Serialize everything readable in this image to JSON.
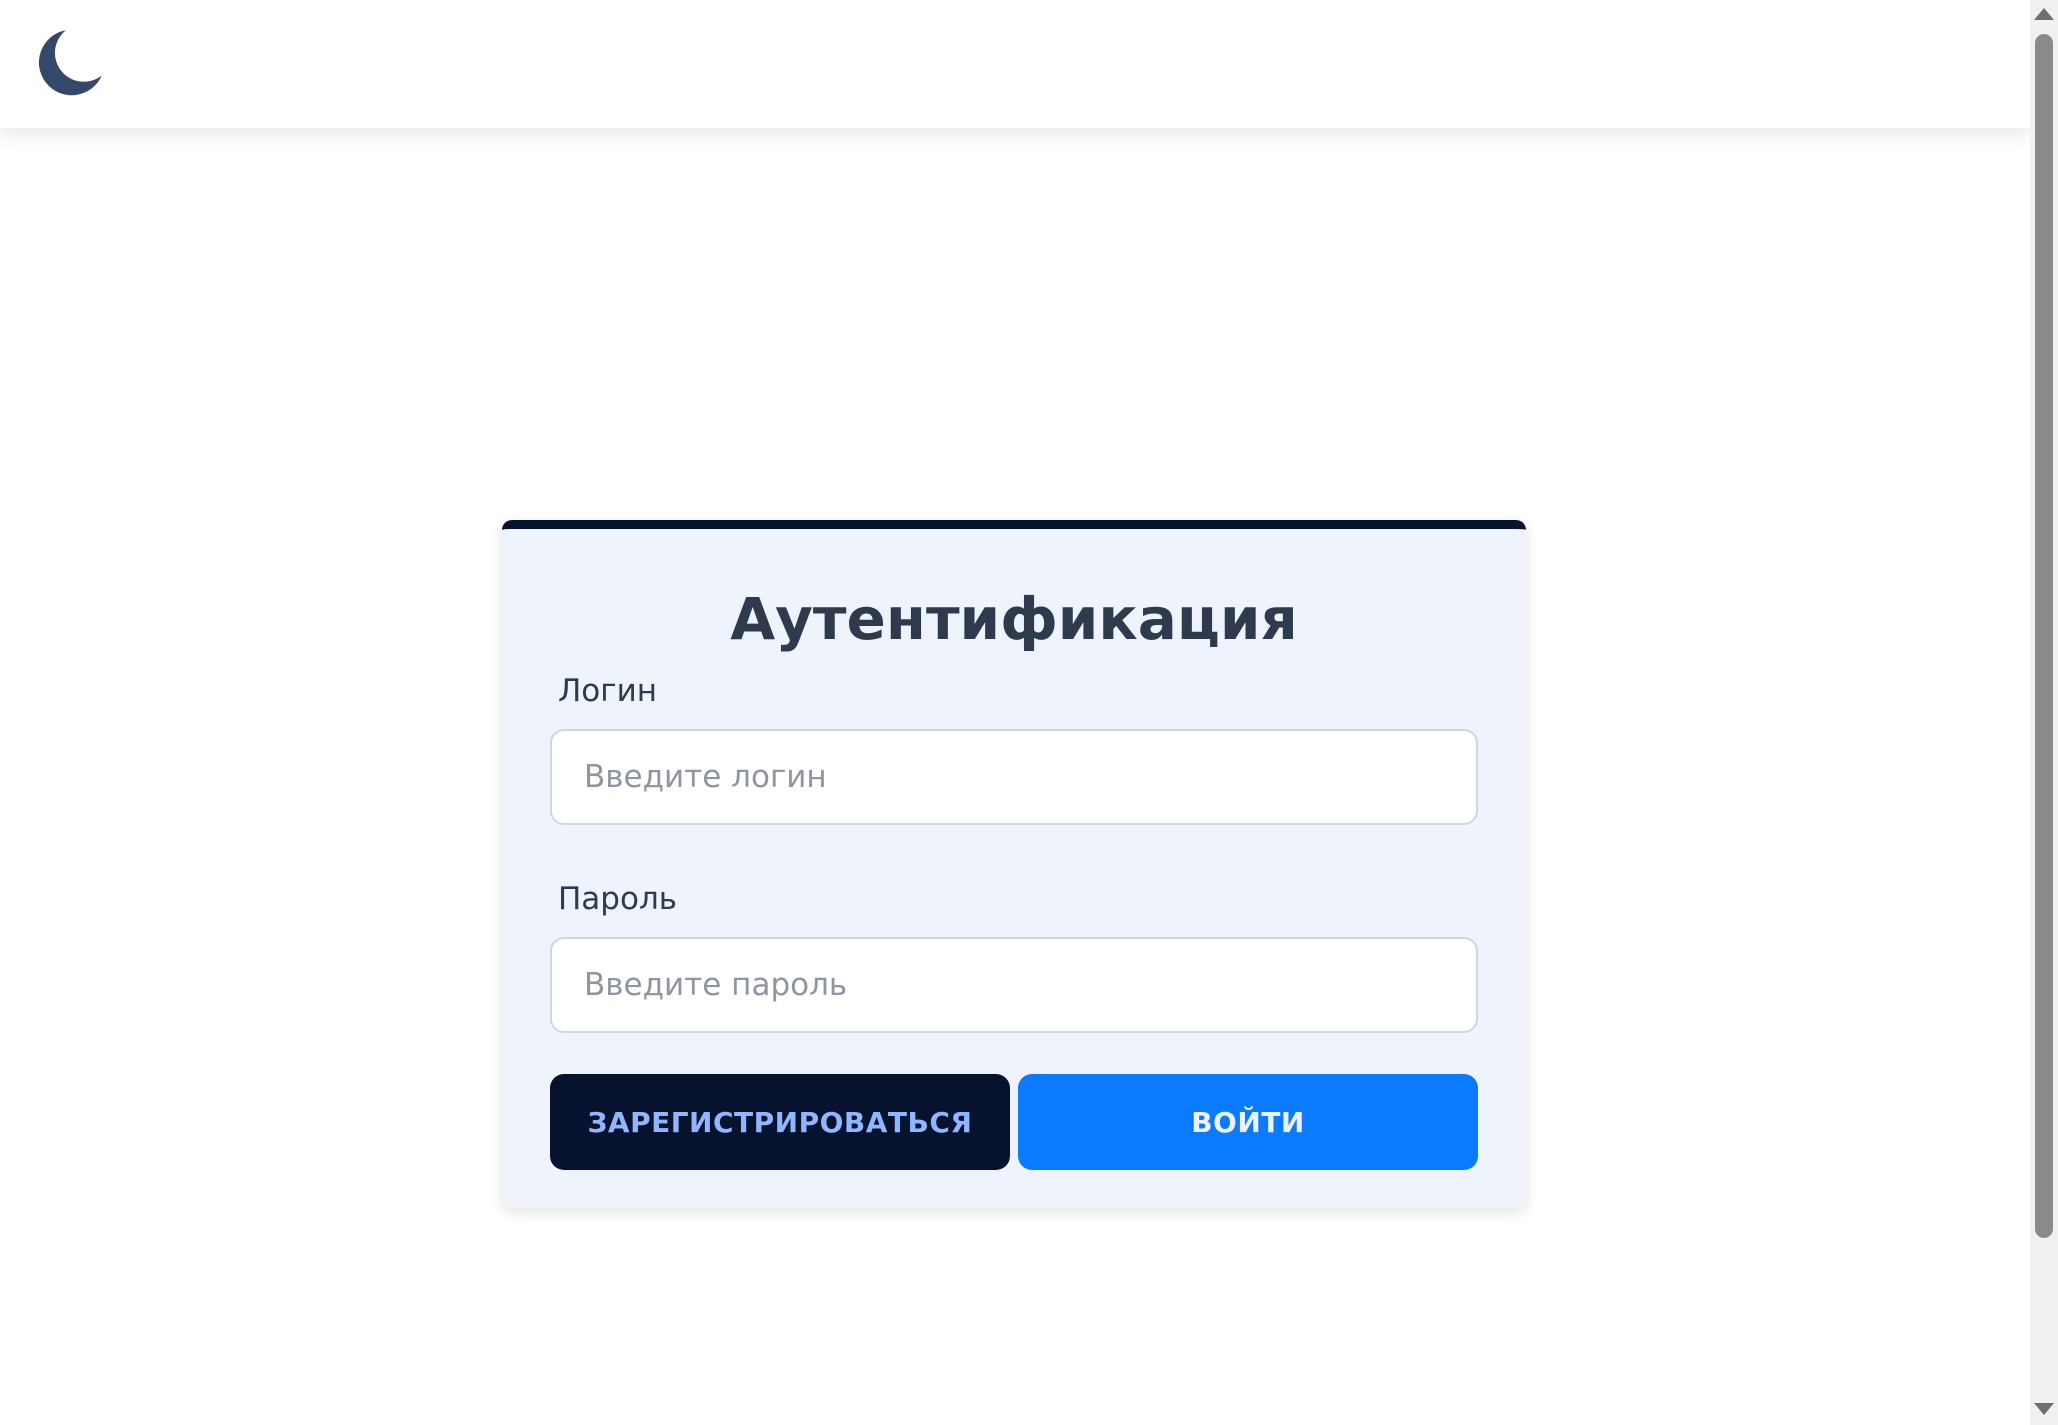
{
  "header": {
    "theme_toggle_icon": "moon-icon",
    "theme_icon_color": "#34496a"
  },
  "auth": {
    "title": "Аутентификация",
    "login_label": "Логин",
    "login_placeholder": "Введите логин",
    "login_value": "",
    "password_label": "Пароль",
    "password_placeholder": "Введите пароль",
    "password_value": "",
    "register_button": "ЗАРЕГИСТРИРОВАТЬСЯ",
    "login_button": "ВОЙТИ"
  },
  "colors": {
    "card_background": "#eff4fc",
    "card_accent": "#06122e",
    "register_button": "#06122e",
    "login_button": "#0a7bff"
  }
}
